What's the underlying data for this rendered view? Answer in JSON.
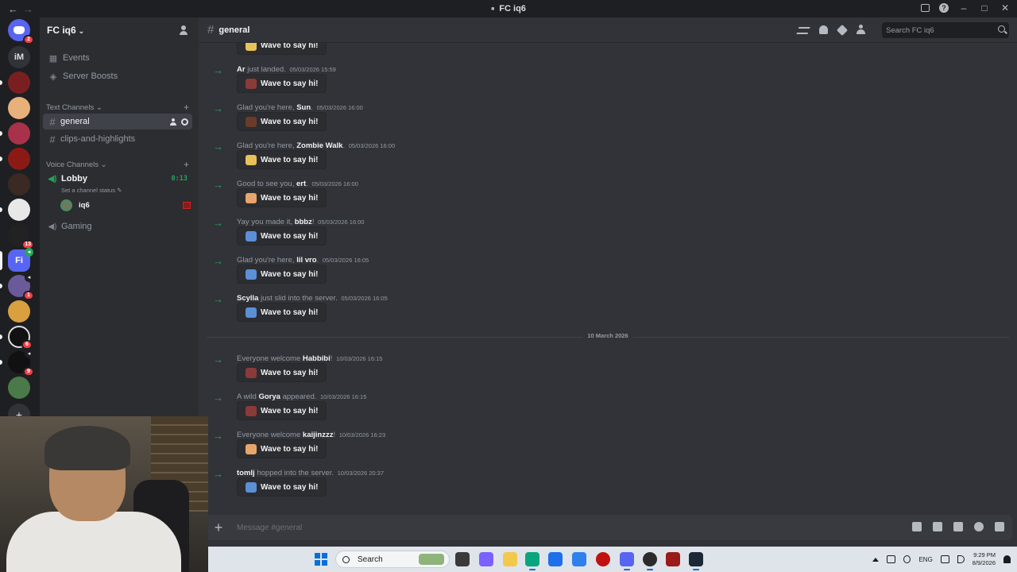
{
  "window": {
    "title": "FC iq6",
    "nav_back": "←",
    "nav_forward": "→"
  },
  "rail": {
    "dm_badge": "2",
    "text_server": "iM",
    "badges": {
      "b1": "13",
      "b2": "1",
      "b3": "1",
      "b4": "6",
      "b5": "9"
    },
    "active_server": "Fi"
  },
  "sidebar": {
    "guild_name": "FC iq6",
    "events_label": "Events",
    "boosts_label": "Server Boosts",
    "text_category": "Text Channels",
    "voice_category": "Voice Channels",
    "channels": [
      "general",
      "clips-and-highlights"
    ],
    "voice": {
      "lobby": "Lobby",
      "lobby_time": "0:13",
      "lobby_status": "Set a channel status",
      "member": "iq6",
      "gaming": "Gaming"
    }
  },
  "header": {
    "channel": "general",
    "search_placeholder": "Search FC iq6"
  },
  "messages": [
    {
      "pre": "",
      "name": "",
      "post": "",
      "ts": "",
      "sticker_color": "#e8c15a"
    },
    {
      "pre": "",
      "name": "Ar",
      "post": " just landed.",
      "ts": "05/03/2026 15:59",
      "sticker_color": "#8b3a3a"
    },
    {
      "pre": "Glad you're here, ",
      "name": "Sun",
      "post": ".",
      "ts": "05/03/2026 16:00",
      "sticker_color": "#6a3b2a"
    },
    {
      "pre": "Glad you're here, ",
      "name": "Zombie Walk",
      "post": ".",
      "ts": "05/03/2026 16:00",
      "sticker_color": "#e8c15a"
    },
    {
      "pre": "Good to see you, ",
      "name": "ert",
      "post": ".",
      "ts": "05/03/2026 16:00",
      "sticker_color": "#e8a56b"
    },
    {
      "pre": "Yay you made it, ",
      "name": "bbbz",
      "post": "!",
      "ts": "05/03/2026 16:00",
      "sticker_color": "#5b8fd6"
    },
    {
      "pre": "Glad you're here, ",
      "name": "lil vro",
      "post": ".",
      "ts": "05/03/2026 16:05",
      "sticker_color": "#5b8fd6"
    },
    {
      "pre": "",
      "name": "Scylla",
      "post": " just slid into the server.",
      "ts": "05/03/2026 16:05",
      "sticker_color": "#5b8fd6"
    },
    {
      "pre": "Everyone welcome ",
      "name": "Habbibi",
      "post": "!",
      "ts": "10/03/2026 16:15",
      "sticker_color": "#8b3a3a"
    },
    {
      "pre": "A wild ",
      "name": "Gorya",
      "post": " appeared.",
      "ts": "10/03/2026 16:15",
      "sticker_color": "#8b3a3a"
    },
    {
      "pre": "Everyone welcome ",
      "name": "kaijinzzz",
      "post": "!",
      "ts": "10/03/2026 16:23",
      "sticker_color": "#e8a56b"
    },
    {
      "pre": "",
      "name": "tomlj",
      "post": " hopped into the server.",
      "ts": "10/03/2026 20:37",
      "sticker_color": "#5b8fd6"
    }
  ],
  "wave_label": "Wave to say hi!",
  "date_divider": "10 March 2026",
  "composer": {
    "placeholder": "Message #general"
  },
  "taskbar": {
    "search": "Search",
    "lang": "ENG",
    "time": "9:29 PM",
    "date": "8/9/2026"
  },
  "colors": {
    "accent": "#5865f2",
    "green": "#23a55a",
    "red": "#f23f43"
  }
}
